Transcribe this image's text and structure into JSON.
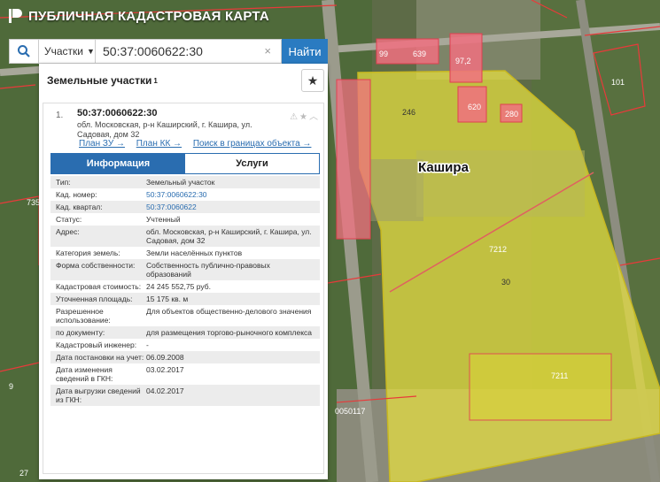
{
  "header": {
    "title": "ПУБЛИЧНАЯ КАДАСТРОВАЯ КАРТА"
  },
  "search": {
    "type_label": "Участки",
    "value": "50:37:0060622:30",
    "find_label": "Найти",
    "clear": "×"
  },
  "panel": {
    "title": "Земельные участки",
    "count_sup": "1",
    "item_number": "1.",
    "cad_number": "50:37:0060622:30",
    "address": "обл. Московская, р-н Каширский, г. Кашира, ул. Садовая, дом 32",
    "links": [
      "План ЗУ →",
      "План КК →",
      "Поиск в границах объекта →"
    ],
    "tabs": [
      "Информация",
      "Услуги"
    ],
    "rows": [
      {
        "k": "Тип:",
        "v": "Земельный участок"
      },
      {
        "k": "Кад. номер:",
        "v": "50:37:0060622:30"
      },
      {
        "k": "Кад. квартал:",
        "v": "50:37:0060622"
      },
      {
        "k": "Статус:",
        "v": "Учтенный"
      },
      {
        "k": "Адрес:",
        "v": "обл. Московская, р-н Каширский, г. Кашира, ул. Садовая, дом 32"
      },
      {
        "k": "Категория земель:",
        "v": "Земли населённых пунктов"
      },
      {
        "k": "Форма собственности:",
        "v": "Собственность публично-правовых образований"
      },
      {
        "k": "Кадастровая стоимость:",
        "v": "24 245 552,75 руб."
      },
      {
        "k": "Уточненная площадь:",
        "v": "15 175 кв. м"
      },
      {
        "k": "Разрешенное использование:",
        "v": "Для объектов общественно-делового значения"
      },
      {
        "k": "по документу:",
        "v": "для размещения торгово-рыночного комплекса"
      },
      {
        "k": "Кадастровый инженер:",
        "v": "-"
      },
      {
        "k": "Дата постановки на учет:",
        "v": "06.09.2008"
      },
      {
        "k": "Дата изменения сведений в ГКН:",
        "v": "03.02.2017"
      },
      {
        "k": "Дата выгрузки сведений из ГКН:",
        "v": "04.02.2017"
      }
    ]
  },
  "map": {
    "city_label": "Кашира",
    "parcel_labels": [
      "99",
      "639",
      "97,2",
      "246",
      "620",
      "280",
      "7212",
      "30",
      "7211",
      "735",
      "0050117",
      "101",
      "9",
      "27"
    ]
  }
}
